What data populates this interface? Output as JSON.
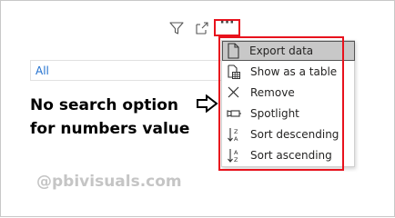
{
  "toolbar": {
    "filter_icon": "filter-icon",
    "focus_icon": "focus-mode-icon",
    "more_icon": "more-options-icon",
    "more_label": "···"
  },
  "slicer": {
    "selected": "All"
  },
  "annotation": {
    "text": "No search option for numbers value",
    "arrow_icon": "right-arrow-icon"
  },
  "watermark": "@pbivisuals.com",
  "menu": {
    "items": [
      {
        "label": "Export data",
        "icon": "export-data-icon",
        "highlighted": true
      },
      {
        "label": "Show as a table",
        "icon": "table-icon",
        "highlighted": false
      },
      {
        "label": "Remove",
        "icon": "close-icon",
        "highlighted": false
      },
      {
        "label": "Spotlight",
        "icon": "spotlight-icon",
        "highlighted": false
      },
      {
        "label": "Sort descending",
        "icon": "sort-descending-icon",
        "highlighted": false
      },
      {
        "label": "Sort ascending",
        "icon": "sort-ascending-icon",
        "highlighted": false
      }
    ]
  },
  "colors": {
    "highlight_red": "#e8121d",
    "link_blue": "#1f6fcf",
    "watermark_gray": "#c5c5c5",
    "menu_highlight": "#c8c8c8"
  }
}
